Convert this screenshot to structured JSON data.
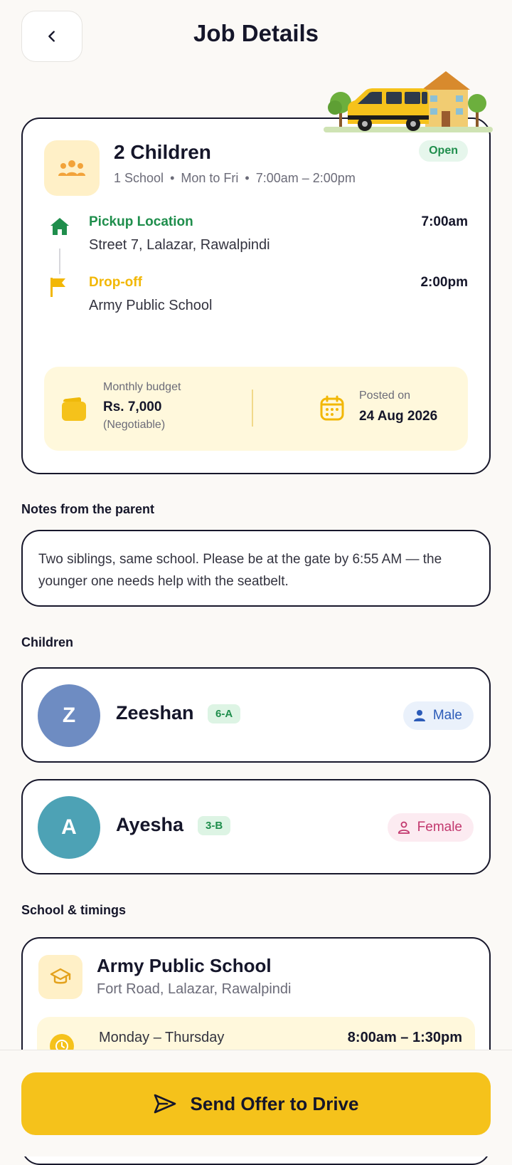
{
  "header": {
    "title": "Job Details",
    "back_icon": "chevron-left-icon"
  },
  "job": {
    "title": "2 Children",
    "meta": [
      "1 School",
      "Mon to Fri",
      "7:00am – 2:00pm"
    ],
    "status": "Open",
    "pickup": {
      "label": "Pickup Location",
      "address": "Street 7, Lalazar, Rawalpindi",
      "time": "7:00am"
    },
    "dropoff": {
      "label": "Drop-off",
      "address": "Army Public School",
      "time": "2:00pm"
    },
    "budget": {
      "caption": "Monthly budget",
      "value": "Rs. 7,000",
      "note": "(Negotiable)"
    },
    "posted": {
      "caption": "Posted on",
      "value": "24 Aug 2026"
    }
  },
  "notes": {
    "heading": "Notes from the parent",
    "text": "Two siblings, same school. Please be at the gate by 6:55 AM — the younger one needs help with the seatbelt."
  },
  "children": {
    "heading": "Children",
    "items": [
      {
        "initial": "Z",
        "name": "Zeeshan",
        "class": "6-A",
        "gender": "Male",
        "avatar_color": "#6E8CC2",
        "badge_bg": "#EAF1FB",
        "badge_color": "#2C5BB8"
      },
      {
        "initial": "A",
        "name": "Ayesha",
        "class": "3-B",
        "gender": "Female",
        "avatar_color": "#4DA2B5",
        "badge_bg": "#FCEBF1",
        "badge_color": "#C2386E"
      }
    ]
  },
  "school": {
    "heading": "School & timings",
    "name": "Army Public School",
    "address": "Fort Road, Lalazar, Rawalpindi",
    "timing": {
      "days": "Monday – Thursday",
      "hours": "8:00am – 1:30pm"
    }
  },
  "footer": {
    "button_label": "Send Offer to Drive"
  },
  "colors": {
    "accent": "#F5C21B",
    "success": "#1F8E4C",
    "dropoff": "#F2B705",
    "ink": "#15162A"
  }
}
